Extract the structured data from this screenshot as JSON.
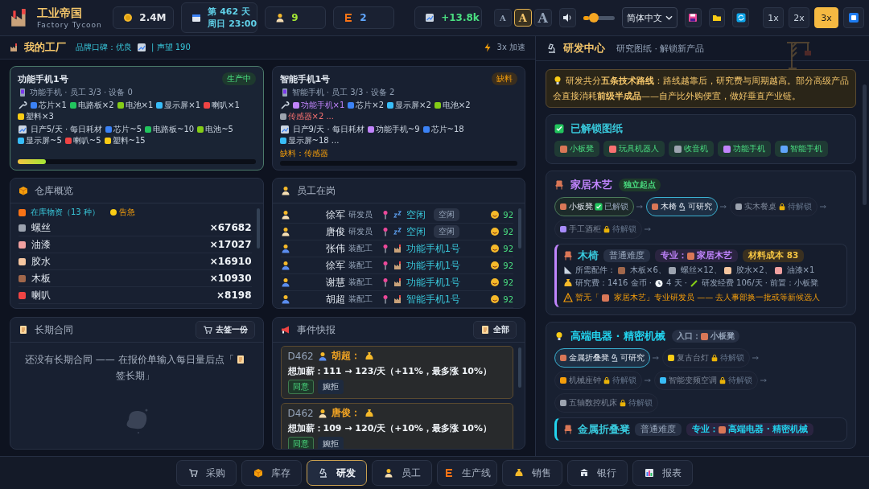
{
  "topbar": {
    "title": "工业帝国",
    "subtitle": "Factory Tycoon",
    "stats": [
      {
        "kind": "coin",
        "value": "2.4M"
      },
      {
        "kind": "date",
        "value": "第 462 天",
        "sub": "周日 23:00"
      },
      {
        "kind": "staff",
        "value": "9"
      },
      {
        "kind": "lines",
        "value": "2"
      },
      {
        "kind": "income",
        "value": "+13.8k"
      }
    ],
    "font_sizes": [
      {
        "label": "A",
        "selected": false
      },
      {
        "label": "A",
        "selected": true
      },
      {
        "label": "A",
        "selected": false
      }
    ],
    "volume": {
      "level": 0.2
    },
    "language": "简体中文",
    "speeds": [
      {
        "label": "1x",
        "selected": false
      },
      {
        "label": "2x",
        "selected": false
      },
      {
        "label": "3x",
        "selected": true
      }
    ]
  },
  "factory": {
    "title": "我的工厂",
    "brand": "品牌口碑：优良",
    "reputation": "| 声望 190",
    "boost": "3x 加速",
    "lines": [
      {
        "name": "功能手机1号",
        "status": "生产中",
        "kind": "running",
        "selected": true,
        "meta": "功能手机 · 员工 3/3 · 设备 0",
        "inputs": [
          {
            "text": "芯片×1",
            "color": "#3b82f6",
            "kind": "normal"
          },
          {
            "text": "电路板×2",
            "color": "#22c55e",
            "kind": "normal"
          },
          {
            "text": "电池×1",
            "color": "#84cc16",
            "kind": "normal"
          },
          {
            "text": "显示屏×1",
            "color": "#38bdf8",
            "kind": "normal"
          },
          {
            "text": "喇叭×1",
            "color": "#ef4444",
            "kind": "normal"
          },
          {
            "text": "塑料×3",
            "color": "#facc15",
            "kind": "normal"
          }
        ],
        "output": "日产5/天 · 每日耗材",
        "consumption": [
          {
            "text": "芯片~5",
            "color": "#3b82f6"
          },
          {
            "text": "电路板~10",
            "color": "#22c55e"
          },
          {
            "text": "电池~5",
            "color": "#84cc16"
          },
          {
            "text": "显示屏~5",
            "color": "#38bdf8"
          },
          {
            "text": "喇叭~5",
            "color": "#ef4444"
          },
          {
            "text": "塑料~15",
            "color": "#facc15"
          }
        ],
        "level": 0.12
      },
      {
        "name": "智能手机1号",
        "status": "缺料",
        "kind": "short",
        "selected": false,
        "meta": "智能手机 · 员工 3/3 · 设备 2",
        "inputs": [
          {
            "text": "功能手机×1",
            "color": "#c084fc",
            "kind": "semi"
          },
          {
            "text": "芯片×2",
            "color": "#3b82f6",
            "kind": "normal"
          },
          {
            "text": "显示屏×2",
            "color": "#38bdf8",
            "kind": "normal"
          },
          {
            "text": "电池×2",
            "color": "#84cc16",
            "kind": "normal"
          },
          {
            "text": "传感器×2 ...",
            "color": "#9ca3af",
            "kind": "missing"
          }
        ],
        "output": "日产9/天 · 每日耗材",
        "consumption": [
          {
            "text": "功能手机~9",
            "color": "#c084fc"
          },
          {
            "text": "芯片~18",
            "color": "#3b82f6"
          },
          {
            "text": "显示屏~18 ...",
            "color": "#38bdf8"
          }
        ],
        "shortage": "缺料：传感器",
        "level": 0
      }
    ]
  },
  "warehouse": {
    "title": "仓库概览",
    "summary": "在库物资（13 种）",
    "alert": "告急",
    "items": [
      {
        "name": "螺丝",
        "qty": "×67682",
        "color": "#9ca3af"
      },
      {
        "name": "油漆",
        "qty": "×17027",
        "color": "#f0a0a0"
      },
      {
        "name": "胶水",
        "qty": "×16910",
        "color": "#f5c6a0"
      },
      {
        "name": "木板",
        "qty": "×10930",
        "color": "#a0674b"
      },
      {
        "name": "喇叭",
        "qty": "×8198",
        "color": "#ef4444"
      }
    ]
  },
  "staff": {
    "title": "员工在岗",
    "rows": [
      {
        "name": "徐军",
        "role": "研发员",
        "kind": "research",
        "task": "空闲",
        "tag": "空闲",
        "mood": "92"
      },
      {
        "name": "唐俊",
        "role": "研发员",
        "kind": "research",
        "task": "空闲",
        "tag": "空闲",
        "mood": "92"
      },
      {
        "name": "张伟",
        "role": "装配工",
        "kind": "worker",
        "task": "功能手机1号",
        "mood": "92"
      },
      {
        "name": "徐军",
        "role": "装配工",
        "kind": "worker",
        "task": "功能手机1号",
        "mood": "92"
      },
      {
        "name": "谢慧",
        "role": "装配工",
        "kind": "worker",
        "task": "功能手机1号",
        "mood": "92"
      },
      {
        "name": "胡超",
        "role": "装配工",
        "kind": "worker",
        "task": "智能手机1号",
        "mood": "92"
      }
    ]
  },
  "contracts": {
    "title": "长期合同",
    "button": "去签一份",
    "empty_before": "还没有长期合同 —— 在报价单输入每日量后点「",
    "empty_after": "签长期」"
  },
  "events": {
    "title": "事件快报",
    "button": "全部",
    "items": [
      {
        "day": "D462",
        "name": "胡超：",
        "kind": "worker",
        "text": "想加薪：111 → 123/天（+11%，最多涨 10%）",
        "accept": "同意",
        "reject": "婉拒"
      },
      {
        "day": "D462",
        "name": "唐俊：",
        "kind": "research",
        "text": "想加薪：109 → 120/天（+10%，最多涨 10%）",
        "accept": "同意",
        "reject": "婉拒"
      }
    ]
  },
  "research": {
    "title": "研发中心",
    "subtitle": "研究图纸 · 解锁新产品",
    "tip": "研发共分**五条技术路线**：路线越靠后，研究费与周期越高。部分高级产品会直接消耗**前级半成品**——自产比外购便宜，做好垂直产业链。",
    "unlocked_title": "已解锁图纸",
    "unlocked": [
      {
        "name": "小板凳",
        "color": "#d97757"
      },
      {
        "name": "玩具机器人",
        "color": "#f87171"
      },
      {
        "name": "收音机",
        "color": "#9ca3af"
      },
      {
        "name": "功能手机",
        "color": "#c084fc"
      },
      {
        "name": "智能手机",
        "color": "#60a5fa"
      }
    ],
    "routes": [
      {
        "title": "家居木艺",
        "color": "#c084fc",
        "badge": "独立起点",
        "nodes": [
          {
            "name": "小板凳",
            "status": "已解锁",
            "kind": "unlocked",
            "selected": false,
            "color": "#d97757"
          },
          {
            "name": "木椅",
            "status": "可研究",
            "kind": "researchable",
            "selected": true,
            "color": "#d97757"
          },
          {
            "name": "实木餐桌",
            "status": "待解锁",
            "kind": "locked",
            "selected": false,
            "color": "#9ca3af"
          },
          {
            "name": "手工酒柜",
            "status": "待解锁",
            "kind": "locked",
            "selected": false,
            "color": "#a78bfa"
          }
        ],
        "detail": {
          "name": "木椅",
          "difficulty": "普通难度",
          "specialty": "专业：",
          "specialty_name": "家居木艺",
          "cost": "材料成本 83",
          "parts_label": "所需配件：",
          "parts": [
            {
              "text": "木板×6、",
              "color": "#a0674b"
            },
            {
              "text": "螺丝×12、",
              "color": "#9ca3af"
            },
            {
              "text": "胶水×2、",
              "color": "#f5c6a0"
            },
            {
              "text": "油漆×1",
              "color": "#f0a0a0"
            }
          ],
          "research": [
            "研究费：1416 金币 ·",
            "4 天 ·",
            "研发经费 106/天 · 前置：小板凳"
          ],
          "warning_before": "暂无「",
          "warning_after": "家居木艺」专业研发员 —— 去人事部换一批或等新候选人"
        }
      },
      {
        "title": "高端电器 · 精密机械",
        "color": "#22d3ee",
        "badge": "入口：",
        "badge_item": "小板凳",
        "nodes": [
          {
            "name": "金属折叠凳",
            "status": "可研究",
            "kind": "researchable",
            "selected": true,
            "color": "#d97757"
          },
          {
            "name": "复古台灯",
            "status": "待解锁",
            "kind": "locked",
            "selected": false,
            "color": "#facc15"
          },
          {
            "name": "机械座钟",
            "status": "待解锁",
            "kind": "locked",
            "selected": false,
            "color": "#f59e0b"
          },
          {
            "name": "智能变频空调",
            "status": "待解锁",
            "kind": "locked",
            "selected": false,
            "color": "#38bdf8"
          },
          {
            "name": "五轴数控机床",
            "status": "待解锁",
            "kind": "locked",
            "selected": false,
            "color": "#9ca3af"
          }
        ],
        "detail": {
          "name": "金属折叠凳",
          "difficulty": "普通难度",
          "specialty": "专业：",
          "specialty_name": "高端电器 · 精密机械"
        }
      }
    ]
  },
  "nav": [
    {
      "label": "采购",
      "selected": false
    },
    {
      "label": "库存",
      "selected": false
    },
    {
      "label": "研发",
      "selected": true
    },
    {
      "label": "员工",
      "selected": false
    },
    {
      "label": "生产线",
      "selected": false
    },
    {
      "label": "销售",
      "selected": false
    },
    {
      "label": "银行",
      "selected": false
    },
    {
      "label": "报表",
      "selected": false
    }
  ]
}
